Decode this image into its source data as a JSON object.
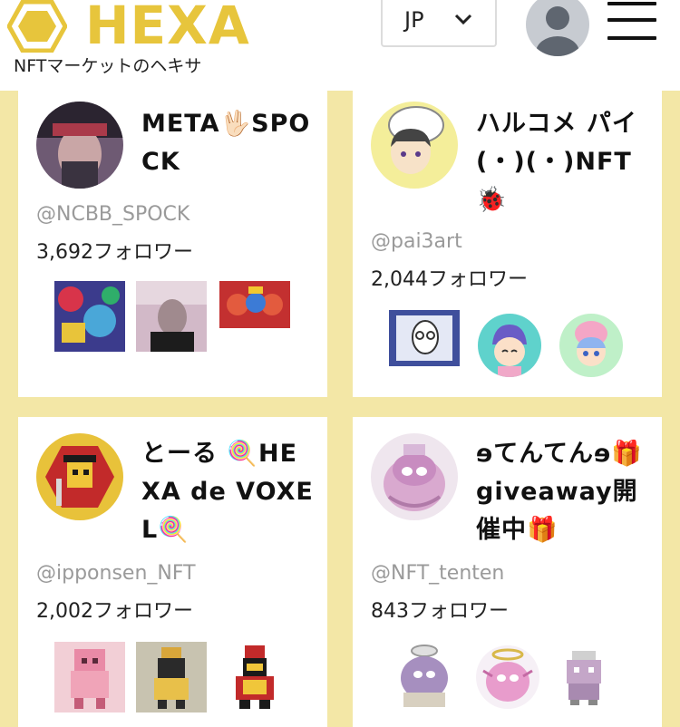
{
  "header": {
    "logo_text": "HEXA",
    "tagline": "NFTマーケットのヘキサ",
    "language": "JP"
  },
  "colors": {
    "brand": "#e7c53c",
    "background": "#f3e7a6",
    "handle": "#9a9a9a"
  },
  "users": [
    {
      "name": "META🖖🏻SPOCK",
      "handle": "@NCBB_SPOCK",
      "followers": "3,692フォロワー"
    },
    {
      "name": "ハルコメ パイ(・)(・)NFT🐞",
      "handle": "@pai3art",
      "followers": "2,044フォロワー"
    },
    {
      "name": "とーる 🍭HEXA de VOXEL🍭",
      "handle": "@ipponsen_NFT",
      "followers": "2,002フォロワー"
    },
    {
      "name": "ɘてんてんɘ🎁giveaway開催中🎁",
      "handle": "@NFT_tenten",
      "followers": "843フォロワー"
    }
  ],
  "icons": {
    "logo": "hexagon-logo-icon",
    "language_toggle": "chevron-down-icon",
    "profile": "user-avatar-icon",
    "menu": "hamburger-menu-icon"
  }
}
